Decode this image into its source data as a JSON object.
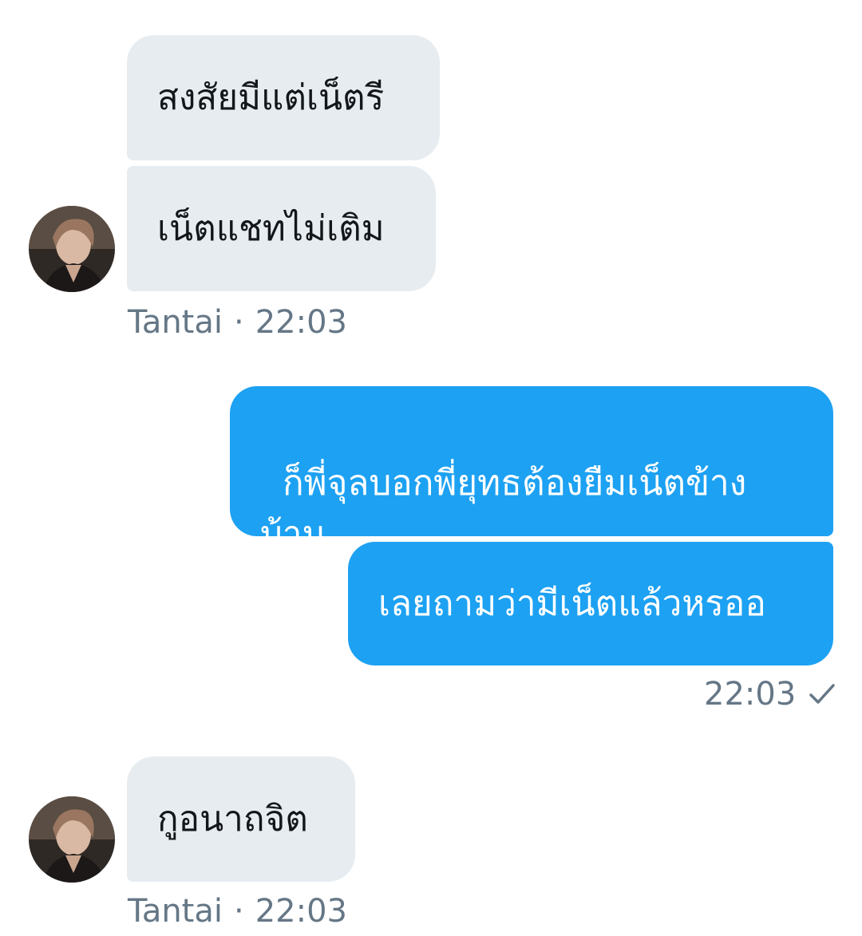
{
  "conversation": {
    "group1": {
      "messages": [
        "สงสัยมีแต่เน็ตรี",
        "เน็ตแชทไม่เติม"
      ],
      "sender": "Tantai",
      "separator": "·",
      "time": "22:03"
    },
    "group2": {
      "messages": [
        "ก็พี่จุลบอกพี่ยุทธต้องยืมเน็ตข้าง\nบ้าน",
        "เลยถามว่ามีเน็ตแล้วหรออ"
      ],
      "time": "22:03",
      "status_icon": "check-icon"
    },
    "group3": {
      "messages": [
        "กูอนาถจิต"
      ],
      "sender": "Tantai",
      "separator": "·",
      "time": "22:03"
    }
  },
  "colors": {
    "incoming_bubble": "#e6ecf0",
    "outgoing_bubble": "#1da1f2",
    "meta_text": "#657786"
  }
}
